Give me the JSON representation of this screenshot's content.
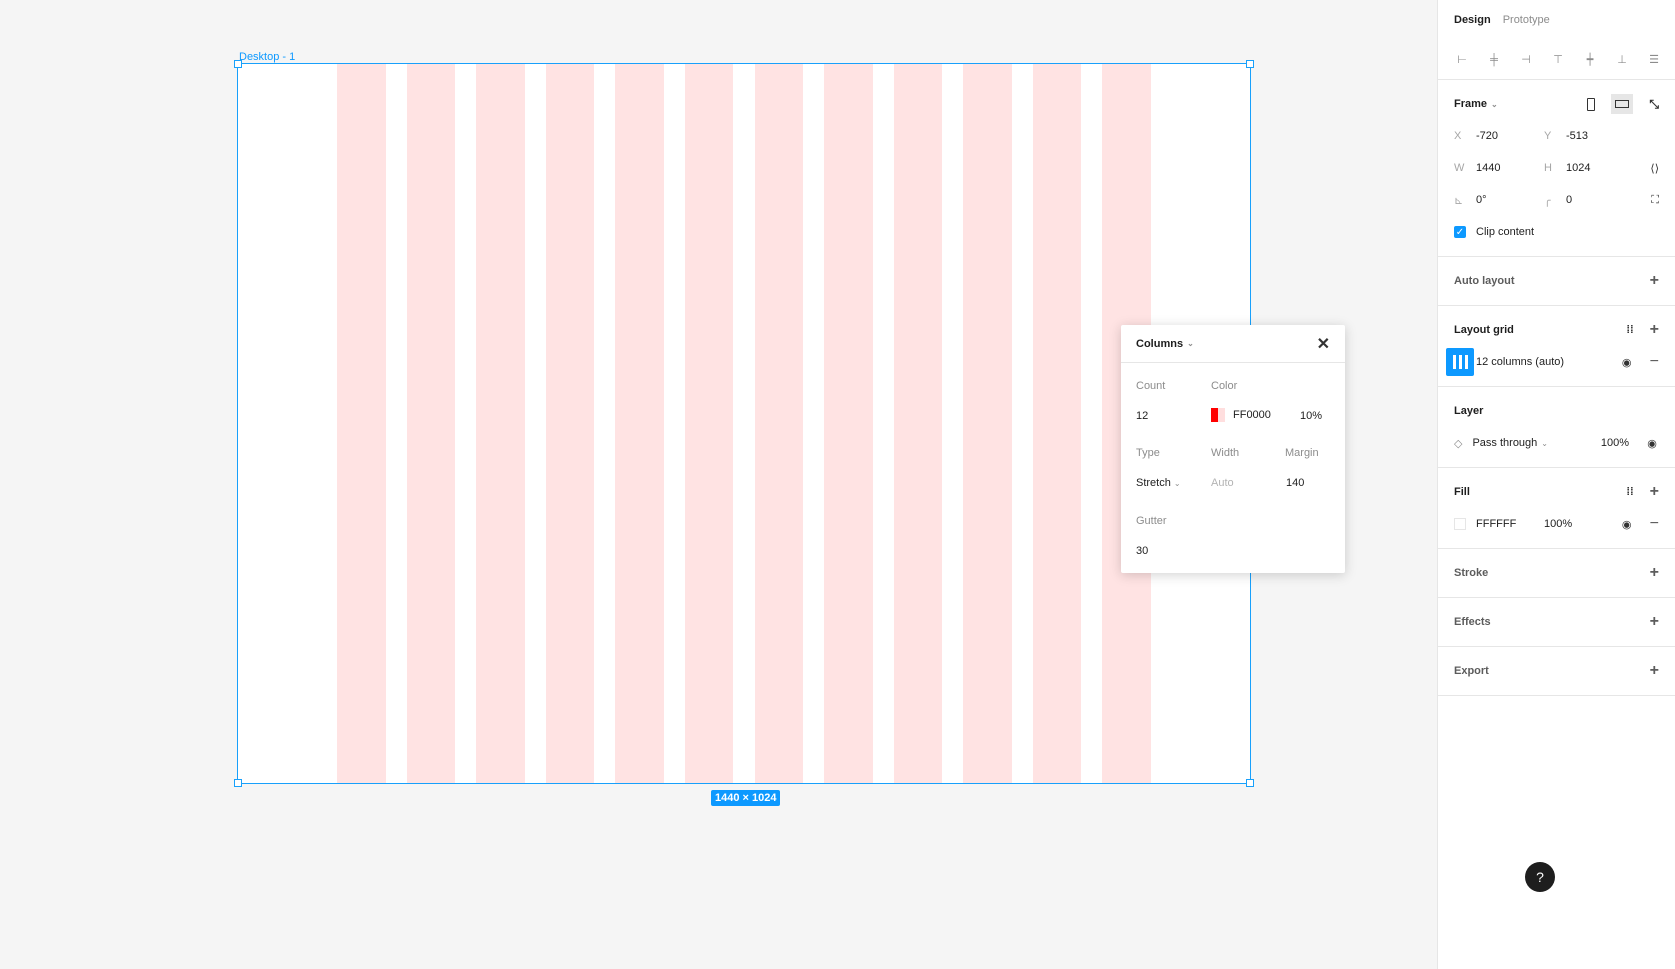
{
  "canvas": {
    "frame_label": "Desktop - 1",
    "dimensions_badge": "1440 × 1024",
    "grid_column_count": 12,
    "grid_color": "#ffe3e3"
  },
  "panel": {
    "tabs": [
      {
        "label": "Design",
        "active": true
      },
      {
        "label": "Prototype",
        "active": false
      }
    ],
    "frame": {
      "title": "Frame",
      "x_label": "X",
      "x_value": "-720",
      "y_label": "Y",
      "y_value": "-513",
      "w_label": "W",
      "w_value": "1440",
      "h_label": "H",
      "h_value": "1024",
      "rotation": "0°",
      "radius": "0",
      "clip_content": "Clip content"
    },
    "auto_layout": "Auto layout",
    "layout_grid": {
      "title": "Layout grid",
      "item": "12 columns (auto)"
    },
    "layer": {
      "title": "Layer",
      "blend": "Pass through",
      "opacity": "100%"
    },
    "fill": {
      "title": "Fill",
      "color": "FFFFFF",
      "opacity": "100%"
    },
    "stroke": "Stroke",
    "effects": "Effects",
    "export": "Export"
  },
  "popup": {
    "title": "Columns",
    "count_label": "Count",
    "count_value": "12",
    "color_label": "Color",
    "color_value": "FF0000",
    "color_opacity": "10%",
    "type_label": "Type",
    "type_value": "Stretch",
    "width_label": "Width",
    "width_value": "Auto",
    "margin_label": "Margin",
    "margin_value": "140",
    "gutter_label": "Gutter",
    "gutter_value": "30"
  },
  "help": "?"
}
